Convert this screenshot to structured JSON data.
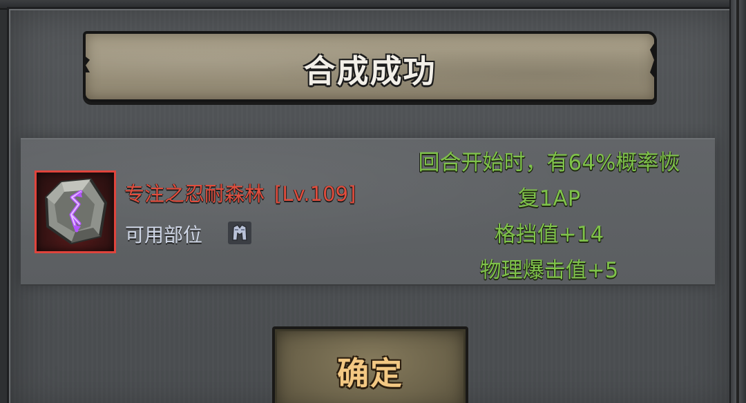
{
  "dialog": {
    "title": "合成成功"
  },
  "item": {
    "name": "专注之忍耐森林",
    "level": "[Lv.109]",
    "slot_label": "可用部位",
    "icon": "rune-stone-icon",
    "slot_icon": "armor-slot-icon",
    "name_color": "#e14d3d",
    "frame_color": "#e0443c"
  },
  "effects": [
    "回合开始时，有64%概率恢",
    "复1AP",
    "格挡值+14",
    "物理爆击值+5"
  ],
  "effect_color": "#7fc24a",
  "confirm": {
    "label": "确定"
  }
}
